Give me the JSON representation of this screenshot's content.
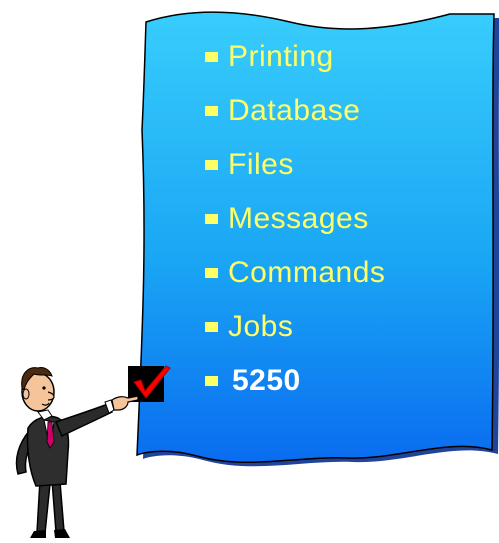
{
  "menu": {
    "items": [
      {
        "label": "Printing"
      },
      {
        "label": "Database"
      },
      {
        "label": "Files"
      },
      {
        "label": "Messages"
      },
      {
        "label": "Commands"
      },
      {
        "label": "Jobs"
      },
      {
        "label": "5250",
        "selected": true
      }
    ]
  },
  "colors": {
    "banner_top": "#33ccff",
    "banner_bottom": "#0066ff",
    "bullet": "#ffff66",
    "selected_text": "#ffffff",
    "check": "#ff0000"
  },
  "icons": {
    "checkbox": "checkmark-icon",
    "figure": "businessman-pointing-clipart"
  }
}
